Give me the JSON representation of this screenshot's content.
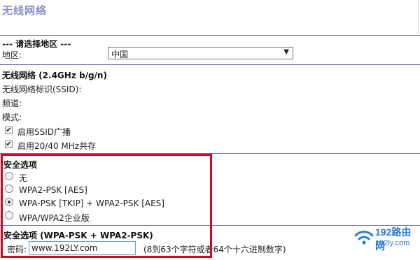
{
  "page": {
    "title": "无线网络"
  },
  "region": {
    "section_title": "--- 请选择地区 ---",
    "label": "地区:",
    "selected": "中国"
  },
  "wireless": {
    "section_title": "无线网络 (2.4GHz b/g/n)",
    "ssid_label": "无线网络标识(SSID):",
    "channel_label": "频道:",
    "mode_label": "模式:",
    "ssid_broadcast": {
      "label": "启用SSID广播",
      "checked": true
    },
    "coexist": {
      "label": "启用20/40 MHz共存",
      "checked": true
    }
  },
  "security": {
    "section_title": "安全选项",
    "options": [
      {
        "label": "无",
        "selected": false
      },
      {
        "label": "WPA2-PSK [AES]",
        "selected": false
      },
      {
        "label": "WPA-PSK [TKIP] + WPA2-PSK [AES]",
        "selected": true
      },
      {
        "label": "WPA/WPA2企业版",
        "selected": false
      }
    ]
  },
  "security_detail": {
    "section_title": "安全选项 (WPA-PSK + WPA2-PSK)",
    "password_label": "密码:",
    "password_value": "www.192LY.com",
    "password_hint": "(8到63个字符或者64个十六进制数字)"
  },
  "watermark": {
    "name": "192路由网",
    "url": "192ly.com",
    "icon": "wifi-icon"
  },
  "colors": {
    "title": "#8a8fc8",
    "rule": "#6a6fb0",
    "highlight_box": "#e0001b",
    "watermark": "#2a7fd0"
  }
}
